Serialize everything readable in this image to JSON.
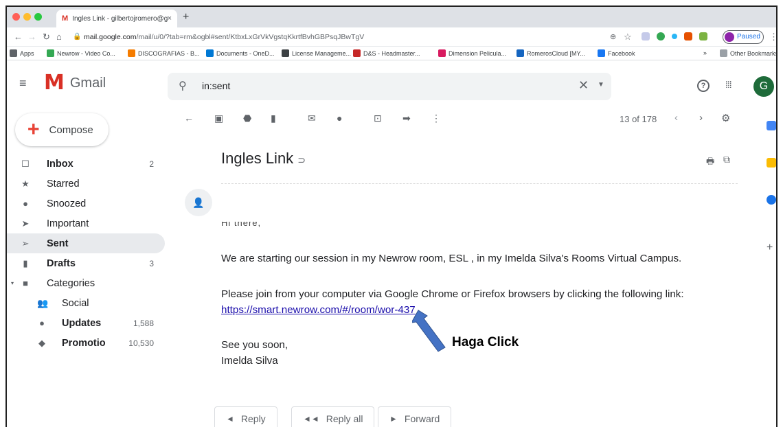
{
  "browser": {
    "tab_title": "Ingles Link - gilbertojromero@g",
    "tab_close": "×",
    "new_tab": "+",
    "url_domain": "mail.google.com",
    "url_path": "/mail/u/0/?tab=rm&ogbl#sent/KtbxLxGrVkVgstqKkrtfBvhGBPsqJBwTgV",
    "paused_label": "Paused",
    "bookmarks": [
      {
        "label": "Apps",
        "color": "#5f6368"
      },
      {
        "label": "Newrow - Video Co...",
        "color": "#34a853"
      },
      {
        "label": "DISCOGRAFIAS - B...",
        "color": "#f57c00"
      },
      {
        "label": "Documents - OneD...",
        "color": "#0078d4"
      },
      {
        "label": "License Manageme...",
        "color": "#3c4043"
      },
      {
        "label": "D&S - Headmaster...",
        "color": "#c62828"
      },
      {
        "label": "Dimension Pelicula...",
        "color": "#d81b60"
      },
      {
        "label": "RomerosCloud [MY...",
        "color": "#1565c0"
      },
      {
        "label": "Facebook",
        "color": "#1877f2"
      }
    ],
    "bookmarks_more": "»",
    "other_bookmarks": "Other Bookmarks"
  },
  "gmail": {
    "logo_text": "Gmail",
    "search_query": "in:sent",
    "avatar_letter": "G",
    "help_label": "?",
    "compose_label": "Compose",
    "nav": [
      {
        "label": "Inbox",
        "count": "2",
        "icon": "inbox-icon",
        "glyph": "☐",
        "bold": true
      },
      {
        "label": "Starred",
        "count": "",
        "icon": "star-icon",
        "glyph": "★",
        "bold": false
      },
      {
        "label": "Snoozed",
        "count": "",
        "icon": "clock-icon",
        "glyph": "●",
        "bold": false
      },
      {
        "label": "Important",
        "count": "",
        "icon": "important-icon",
        "glyph": "➤",
        "bold": false
      },
      {
        "label": "Sent",
        "count": "",
        "icon": "send-icon",
        "glyph": "➢",
        "bold": true,
        "active": true
      },
      {
        "label": "Drafts",
        "count": "3",
        "icon": "draft-icon",
        "glyph": "▮",
        "bold": true
      },
      {
        "label": "Categories",
        "count": "",
        "icon": "label-icon",
        "glyph": "■",
        "bold": false
      },
      {
        "label": "Social",
        "count": "",
        "icon": "people-icon",
        "glyph": "👥",
        "bold": false,
        "sub": true
      },
      {
        "label": "Updates",
        "count": "1,588",
        "icon": "info-icon",
        "glyph": "●",
        "bold": true,
        "sub": true
      },
      {
        "label": "Promotio",
        "count": "10,530",
        "icon": "tag-icon",
        "glyph": "◆",
        "bold": true,
        "sub": true
      }
    ],
    "pager_text": "13 of 178"
  },
  "message": {
    "subject": "Ingles Link",
    "greeting_cut": "Hi there,",
    "line1": "We are starting our session in my Newrow room, ESL , in my Imelda Silva's Rooms Virtual Campus.",
    "line2": "Please join from your computer via Google Chrome or Firefox browsers by clicking the following link:",
    "link": "https://smart.newrow.com/#/room/wor-437",
    "signoff": "See you soon,",
    "signature": "Imelda Silva",
    "reply": "Reply",
    "reply_all": "Reply all",
    "forward": "Forward"
  },
  "annotation": {
    "text": "Haga Click",
    "arrow_color": "#4472c4"
  }
}
